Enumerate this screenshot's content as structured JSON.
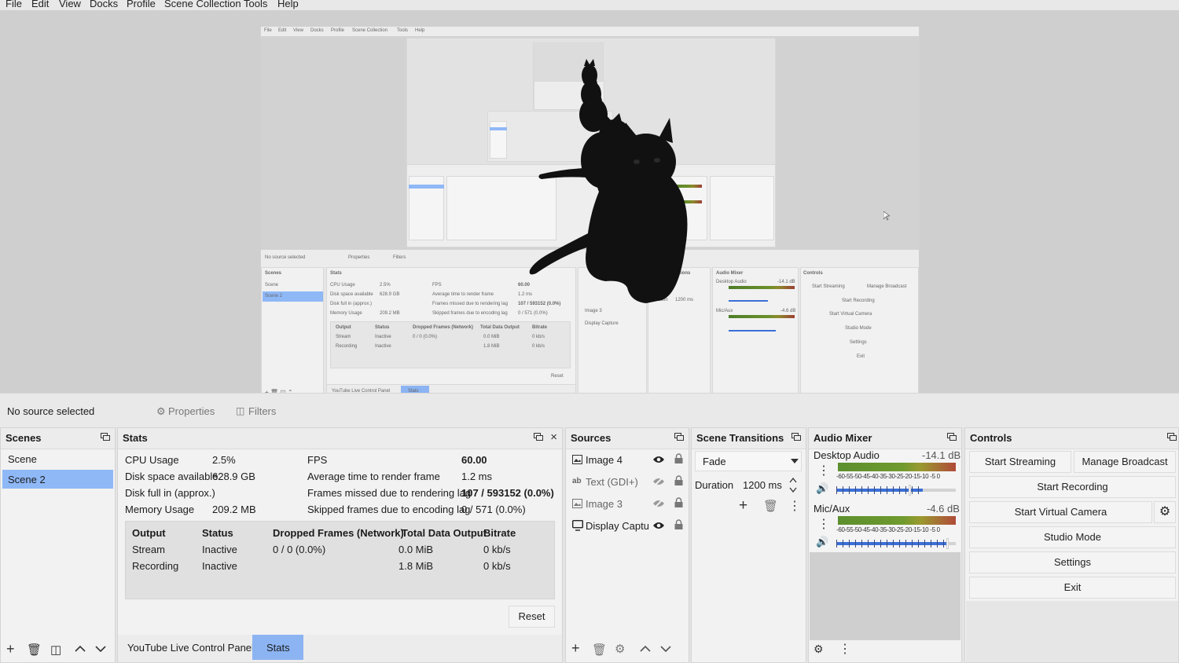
{
  "menu": [
    "File",
    "Edit",
    "View",
    "Docks",
    "Profile",
    "Scene Collection",
    "Tools",
    "Help"
  ],
  "preview": {
    "nested_menu": [
      "File",
      "Edit",
      "View",
      "Docks",
      "Profile",
      "Scene Collection",
      "Tools",
      "Help"
    ],
    "nested_no_source": "No source selected",
    "nested_properties": "Properties",
    "nested_filters": "Filters",
    "nested_scenes_title": "Scenes",
    "nested_scenes": [
      "Scene",
      "Scene 2"
    ],
    "nested_stats_title": "Stats",
    "nested_stats_left": [
      "CPU Usage",
      "Disk space available",
      "Disk full in (approx.)",
      "Memory Usage"
    ],
    "nested_stats_left_vals": [
      "2.5%",
      "628.9 GB",
      "",
      "209.2 MB"
    ],
    "nested_stats_right": [
      "FPS",
      "Average time to render frame",
      "Frames missed due to rendering lag",
      "Skipped frames due to encoding lag"
    ],
    "nested_stats_right_vals": [
      "60.00",
      "1.2 ms",
      "107 / 593152 (0.0%)",
      "0 / 571 (0.0%)"
    ],
    "nested_table_headers": [
      "Output",
      "Status",
      "Dropped Frames (Network)",
      "Total Data Output",
      "Bitrate"
    ],
    "nested_rows": [
      [
        "Stream",
        "Inactive",
        "0 / 0 (0.0%)",
        "0.0 MiB",
        "0 kb/s"
      ],
      [
        "Recording",
        "Inactive",
        "",
        "1.8 MiB",
        "0 kb/s"
      ]
    ],
    "nested_reset": "Reset",
    "nested_tab_ytb": "YouTube Live Control Panel",
    "nested_tab_stats": "Stats",
    "nested_sources": [
      "Image 3",
      "Display Capture"
    ],
    "nested_transitions_title": "Scene Transitions",
    "nested_duration": "Duration",
    "nested_duration_val": "1200 ms",
    "nested_audio_title": "Audio Mixer",
    "nested_desktop": "Desktop Audio",
    "nested_desktop_db": "-14.1 dB",
    "nested_mic": "Mic/Aux",
    "nested_mic_db": "-4.6 dB",
    "nested_controls_title": "Controls",
    "nested_controls": [
      "Start Streaming",
      "Manage Broadcast",
      "Start Recording",
      "Start Virtual Camera",
      "Studio Mode",
      "Settings",
      "Exit"
    ]
  },
  "source_toolbar": {
    "no_source": "No source selected",
    "properties": "Properties",
    "filters": "Filters"
  },
  "scenes": {
    "title": "Scenes",
    "items": [
      "Scene",
      "Scene 2"
    ],
    "selected_index": 1
  },
  "stats": {
    "title": "Stats",
    "left_labels": [
      "CPU Usage",
      "Disk space available",
      "Disk full in (approx.)",
      "Memory Usage"
    ],
    "left_values": [
      "2.5%",
      "628.9 GB",
      "",
      "209.2 MB"
    ],
    "right_labels": [
      "FPS",
      "Average time to render frame",
      "Frames missed due to rendering lag",
      "Skipped frames due to encoding lag"
    ],
    "right_values": [
      "60.00",
      "1.2 ms",
      "107 / 593152 (0.0%)",
      "0 / 571 (0.0%)"
    ],
    "table_headers": [
      "Output",
      "Status",
      "Dropped Frames (Network)",
      "Total Data Output",
      "Bitrate"
    ],
    "rows": [
      [
        "Stream",
        "Inactive",
        "0 / 0 (0.0%)",
        "0.0 MiB",
        "0 kb/s"
      ],
      [
        "Recording",
        "Inactive",
        "",
        "1.8 MiB",
        "0 kb/s"
      ]
    ],
    "reset": "Reset"
  },
  "bottom_tabs": {
    "youtube": "YouTube Live Control Panel",
    "stats": "Stats"
  },
  "sources": {
    "title": "Sources",
    "items": [
      {
        "label": "Image 4",
        "icon": "image-icon",
        "visible": true
      },
      {
        "label": "Text (GDI+)",
        "icon": "text-icon",
        "visible": false
      },
      {
        "label": "Image 3",
        "icon": "image-icon",
        "visible": false
      },
      {
        "label": "Display Captur",
        "icon": "monitor-icon",
        "visible": true
      }
    ]
  },
  "transitions": {
    "title": "Scene Transitions",
    "selected": "Fade",
    "duration_label": "Duration",
    "duration_value": "1200 ms"
  },
  "audio": {
    "title": "Audio Mixer",
    "channels": [
      {
        "name": "Desktop Audio",
        "db": "-14.1 dB",
        "volume": 0.6
      },
      {
        "name": "Mic/Aux",
        "db": "-4.6 dB",
        "volume": 0.8
      }
    ],
    "scale": "-60-55-50-45-40-35-30-25-20-15-10 -5  0"
  },
  "controls": {
    "title": "Controls",
    "start_streaming": "Start Streaming",
    "manage_broadcast": "Manage Broadcast",
    "start_recording": "Start Recording",
    "start_virtual_camera": "Start Virtual Camera",
    "studio_mode": "Studio Mode",
    "settings": "Settings",
    "exit": "Exit"
  },
  "colors": {
    "selected": "#8fb8f7",
    "tab_active": "#8cb4f3",
    "cat": "#0f0f10"
  }
}
